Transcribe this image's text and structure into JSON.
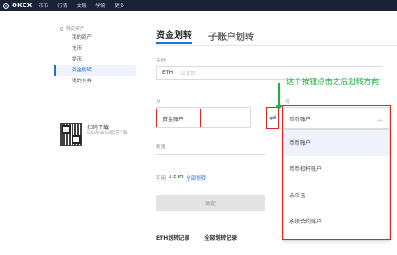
{
  "header": {
    "logo": "OKEX",
    "nav": [
      "币币",
      "行情",
      "交易",
      "学院",
      "更多"
    ]
  },
  "sidebar": {
    "section_title": "我的资产",
    "items": [
      {
        "label": "我的资产",
        "active": false
      },
      {
        "label": "充币",
        "active": false
      },
      {
        "label": "提币",
        "active": false
      },
      {
        "label": "资金划转",
        "active": true
      },
      {
        "label": "我的卡券",
        "active": false
      }
    ]
  },
  "qr": {
    "title": "扫码下载",
    "subtitle": "iOS/Android官方下载"
  },
  "tabs": [
    {
      "label": "资金划转",
      "active": true
    },
    {
      "label": "子账户划转",
      "active": false
    }
  ],
  "form": {
    "coin_label": "币种",
    "coin_value": "ETH",
    "coin_placeholder": "以太坊",
    "from_label": "从",
    "from_value": "资金账户",
    "swap_symbol": "⇌",
    "to_label": "到",
    "to_value": "币币账户",
    "quantity_label": "数量",
    "available_label": "可用",
    "available_value": "0 ETH",
    "transfer_all": "全部划转",
    "confirm_button": "确定"
  },
  "dropdown": {
    "options": [
      "币币账户",
      "币币杠杆账户",
      "余币宝",
      "永续合约账户"
    ]
  },
  "annotation": {
    "text": "这个按钮点击之后划转方向"
  },
  "records": [
    "ETH划转记录",
    "全部划转记录"
  ],
  "colors": {
    "accent": "#1f6fd6",
    "nav_bg": "#1a2236",
    "annotation_green": "#19b53a",
    "highlight_red": "#e02424"
  }
}
